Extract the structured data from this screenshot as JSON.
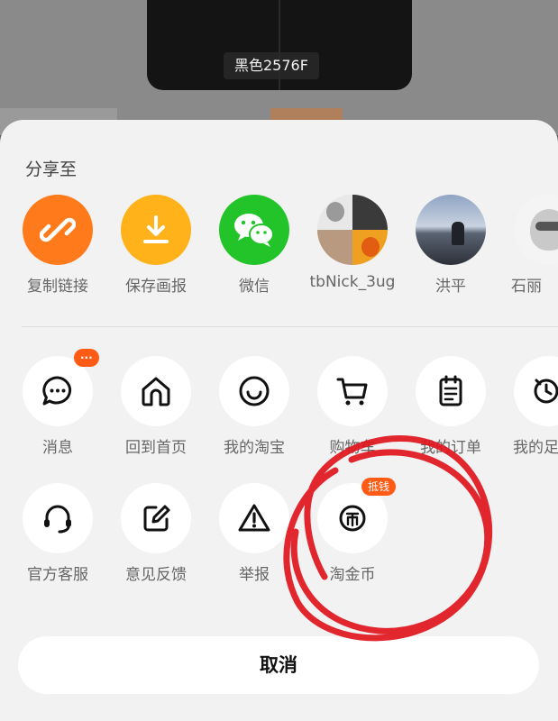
{
  "product": {
    "color_tag": "黑色2576F"
  },
  "sheet": {
    "title": "分享至"
  },
  "share_targets": [
    {
      "label": "复制链接",
      "icon": "link-icon",
      "color": "#ff7a1a"
    },
    {
      "label": "保存画报",
      "icon": "download-icon",
      "color": "#ffb21a"
    },
    {
      "label": "微信",
      "icon": "wechat-icon",
      "color": "#22c42a"
    },
    {
      "label": "tbNick_3ug",
      "icon": "avatar-collage"
    },
    {
      "label": "洪平",
      "icon": "avatar-photo"
    },
    {
      "label": "石丽",
      "icon": "avatar-cartoon"
    }
  ],
  "actions_row1": [
    {
      "label": "消息",
      "icon": "message-icon",
      "badge": "···"
    },
    {
      "label": "回到首页",
      "icon": "home-icon"
    },
    {
      "label": "我的淘宝",
      "icon": "smile-icon"
    },
    {
      "label": "购物车",
      "icon": "cart-icon"
    },
    {
      "label": "我的订单",
      "icon": "order-icon"
    },
    {
      "label": "我的足迹",
      "icon": "footprint-icon"
    }
  ],
  "actions_row2": [
    {
      "label": "官方客服",
      "icon": "headset-icon"
    },
    {
      "label": "意见反馈",
      "icon": "edit-icon"
    },
    {
      "label": "举报",
      "icon": "warning-icon"
    },
    {
      "label": "淘金币",
      "icon": "coin-icon",
      "badge": "抵钱"
    }
  ],
  "cancel": {
    "label": "取消"
  },
  "colors": {
    "accent": "#ff5b14",
    "scribble": "#e0151e"
  }
}
